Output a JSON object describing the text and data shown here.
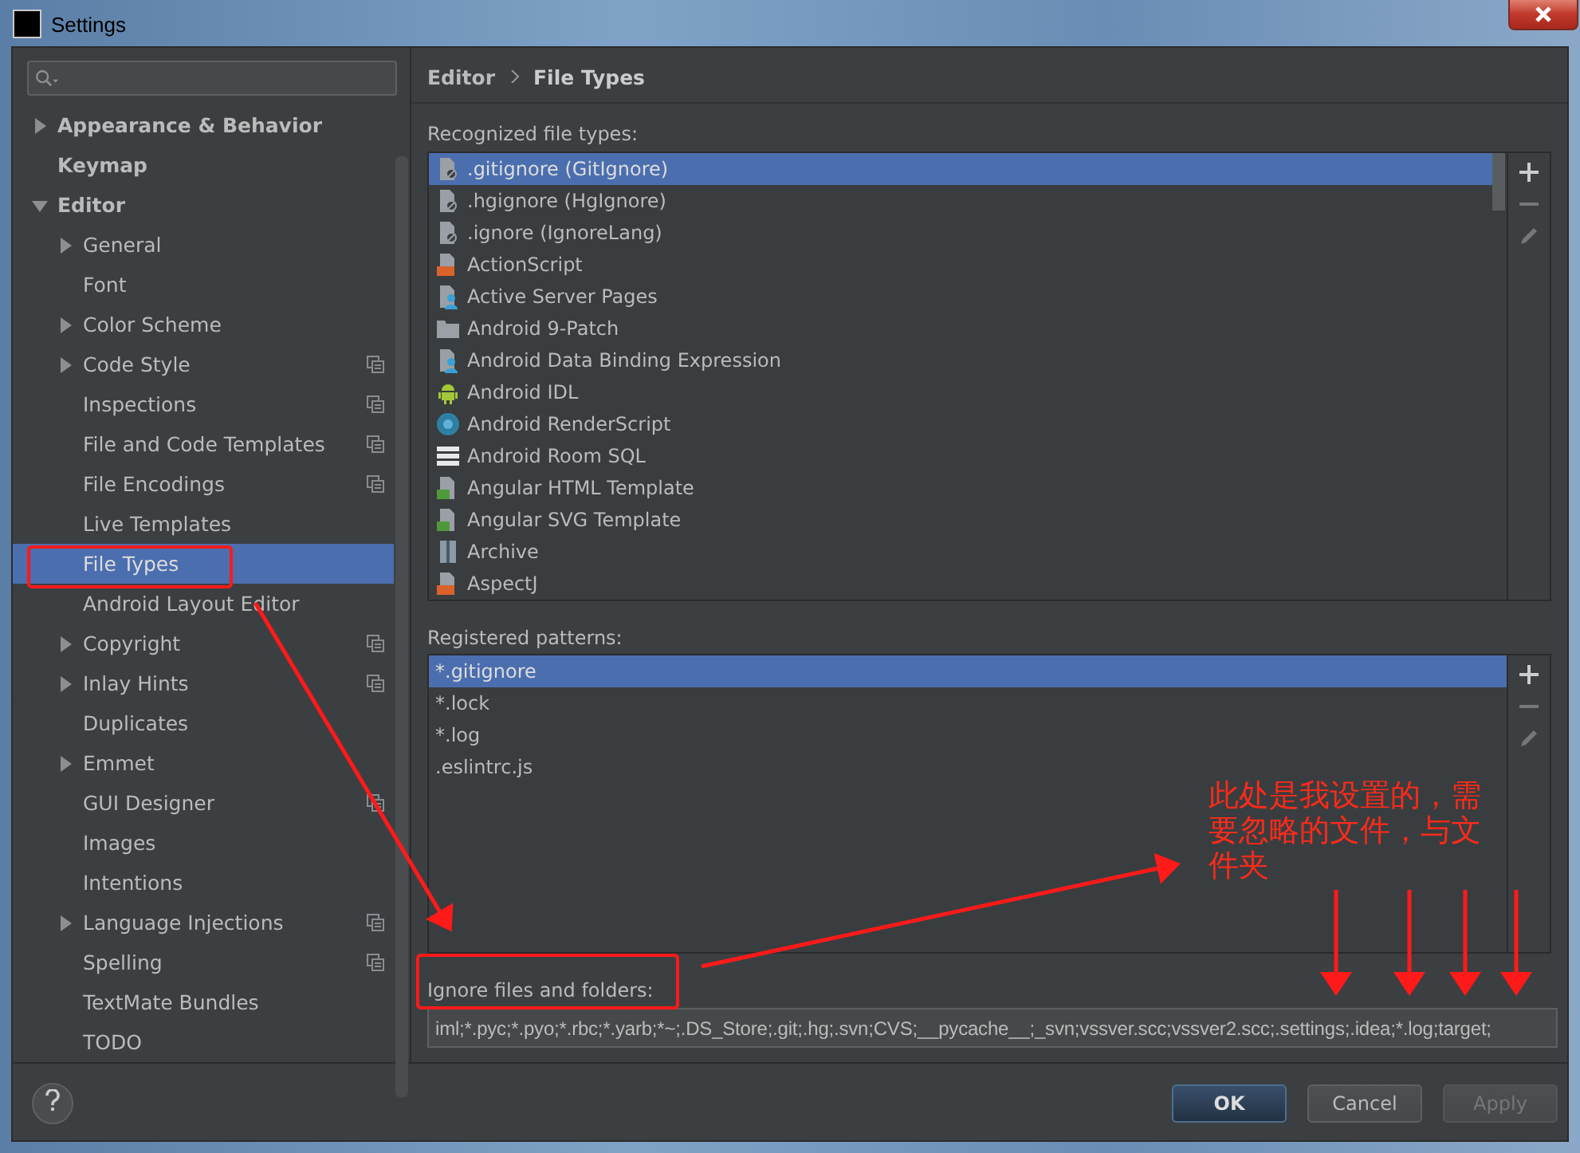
{
  "window": {
    "title": "Settings"
  },
  "sidebar": {
    "items": [
      {
        "label": "Appearance & Behavior",
        "kind": "group",
        "expanded": false,
        "selected": false,
        "shared": false
      },
      {
        "label": "Keymap",
        "kind": "leaf",
        "selected": false,
        "shared": false
      },
      {
        "label": "Editor",
        "kind": "group",
        "expanded": true,
        "selected": false,
        "shared": false,
        "children": [
          {
            "label": "General",
            "kind": "group",
            "expanded": false,
            "selected": false,
            "shared": false
          },
          {
            "label": "Font",
            "kind": "leaf",
            "selected": false,
            "shared": false
          },
          {
            "label": "Color Scheme",
            "kind": "group",
            "expanded": false,
            "selected": false,
            "shared": false
          },
          {
            "label": "Code Style",
            "kind": "group",
            "expanded": false,
            "selected": false,
            "shared": true
          },
          {
            "label": "Inspections",
            "kind": "leaf",
            "selected": false,
            "shared": true
          },
          {
            "label": "File and Code Templates",
            "kind": "leaf",
            "selected": false,
            "shared": true
          },
          {
            "label": "File Encodings",
            "kind": "leaf",
            "selected": false,
            "shared": true
          },
          {
            "label": "Live Templates",
            "kind": "leaf",
            "selected": false,
            "shared": false
          },
          {
            "label": "File Types",
            "kind": "leaf",
            "selected": true,
            "shared": false
          },
          {
            "label": "Android Layout Editor",
            "kind": "leaf",
            "selected": false,
            "shared": false
          },
          {
            "label": "Copyright",
            "kind": "group",
            "expanded": false,
            "selected": false,
            "shared": true
          },
          {
            "label": "Inlay Hints",
            "kind": "group",
            "expanded": false,
            "selected": false,
            "shared": true
          },
          {
            "label": "Duplicates",
            "kind": "leaf",
            "selected": false,
            "shared": false
          },
          {
            "label": "Emmet",
            "kind": "group",
            "expanded": false,
            "selected": false,
            "shared": false
          },
          {
            "label": "GUI Designer",
            "kind": "leaf",
            "selected": false,
            "shared": true
          },
          {
            "label": "Images",
            "kind": "leaf",
            "selected": false,
            "shared": false
          },
          {
            "label": "Intentions",
            "kind": "leaf",
            "selected": false,
            "shared": false
          },
          {
            "label": "Language Injections",
            "kind": "group",
            "expanded": false,
            "selected": false,
            "shared": true
          },
          {
            "label": "Spelling",
            "kind": "leaf",
            "selected": false,
            "shared": true
          },
          {
            "label": "TextMate Bundles",
            "kind": "leaf",
            "selected": false,
            "shared": false
          },
          {
            "label": "TODO",
            "kind": "leaf",
            "selected": false,
            "shared": false
          }
        ]
      }
    ]
  },
  "breadcrumb": [
    "Editor",
    "File Types"
  ],
  "recognized": {
    "label": "Recognized file types:",
    "items": [
      {
        "label": ".gitignore (GitIgnore)",
        "kind": "ignore",
        "selected": true
      },
      {
        "label": ".hgignore (HgIgnore)",
        "kind": "ignore",
        "selected": false
      },
      {
        "label": ".ignore (IgnoreLang)",
        "kind": "ignore",
        "selected": false
      },
      {
        "label": "ActionScript",
        "kind": "as",
        "selected": false
      },
      {
        "label": "Active Server Pages",
        "kind": "person",
        "selected": false
      },
      {
        "label": "Android 9-Patch",
        "kind": "folder",
        "selected": false
      },
      {
        "label": "Android Data Binding Expression",
        "kind": "person",
        "selected": false
      },
      {
        "label": "Android IDL",
        "kind": "android",
        "selected": false
      },
      {
        "label": "Android RenderScript",
        "kind": "rs",
        "selected": false
      },
      {
        "label": "Android Room SQL",
        "kind": "table",
        "selected": false
      },
      {
        "label": "Angular HTML Template",
        "kind": "html",
        "selected": false
      },
      {
        "label": "Angular SVG Template",
        "kind": "html",
        "selected": false
      },
      {
        "label": "Archive",
        "kind": "archive",
        "selected": false
      },
      {
        "label": "AspectJ",
        "kind": "as",
        "selected": false
      }
    ]
  },
  "patterns": {
    "label": "Registered patterns:",
    "items": [
      {
        "label": "*.gitignore",
        "selected": true
      },
      {
        "label": "*.lock",
        "selected": false
      },
      {
        "label": "*.log",
        "selected": false
      },
      {
        "label": ".eslintrc.js",
        "selected": false
      }
    ]
  },
  "ignore": {
    "label": "Ignore files and folders:",
    "value": "iml;*.pyc;*.pyo;*.rbc;*.yarb;*~;.DS_Store;.git;.hg;.svn;CVS;__pycache__;_svn;vssver.scc;vssver2.scc;.settings;.idea;*.log;target;"
  },
  "buttons": [
    {
      "label": "OK",
      "kind": "default",
      "disabled": false
    },
    {
      "label": "Cancel",
      "kind": "normal",
      "disabled": false
    },
    {
      "label": "Apply",
      "kind": "normal",
      "disabled": true
    }
  ],
  "annotation": {
    "note": "此处是我设置的，需要忽略的文件，与文件夹"
  }
}
